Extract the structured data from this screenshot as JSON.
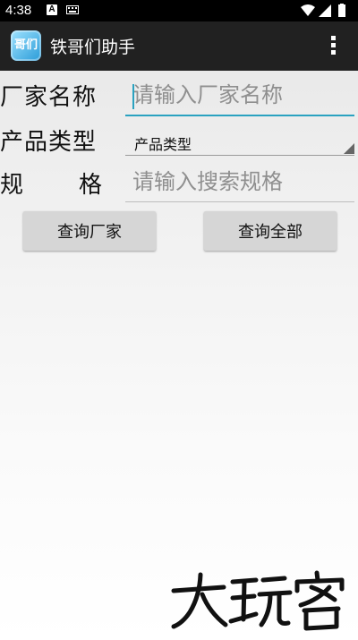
{
  "status_bar": {
    "time": "4:38",
    "notification_icons": [
      "a-box-icon",
      "keyboard-icon"
    ],
    "right_icons": [
      "wifi-icon",
      "signal-icon",
      "battery-icon"
    ]
  },
  "app_bar": {
    "logo_text": "哥们",
    "title": "铁哥们助手",
    "menu_icon": "overflow-menu-icon"
  },
  "form": {
    "manufacturer_label": "厂家名称",
    "manufacturer_placeholder": "请输入厂家名称",
    "product_type_label": "产品类型",
    "product_type_selected": "产品类型",
    "spec_label_chars": [
      "规",
      "格"
    ],
    "spec_placeholder": "请输入搜索规格"
  },
  "buttons": {
    "query_manufacturer": "查询厂家",
    "query_all": "查询全部"
  },
  "watermark": "大玩客",
  "colors": {
    "status_bar": "#000000",
    "app_bar": "#212121",
    "accent": "#2aa2c0",
    "button": "#d6d6d6"
  }
}
